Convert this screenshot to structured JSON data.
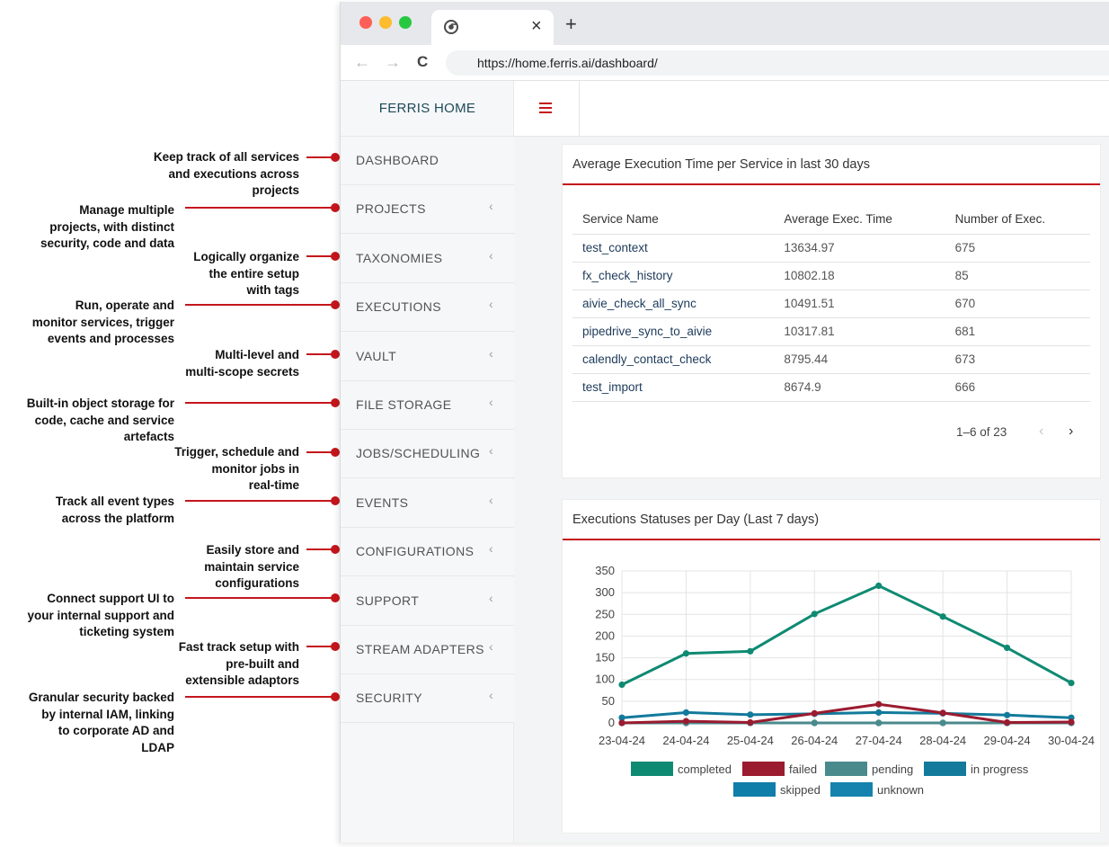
{
  "annotations": [
    {
      "lines": [
        "Keep track of all services",
        "and executions across",
        "projects"
      ]
    },
    {
      "lines": [
        "Manage multiple",
        "projects, with distinct",
        "security, code and data"
      ]
    },
    {
      "lines": [
        "Logically organize",
        "the entire setup",
        "with tags"
      ]
    },
    {
      "lines": [
        "Run, operate and",
        "monitor  services, trigger",
        "events and processes"
      ]
    },
    {
      "lines": [
        "Multi-level and",
        "multi-scope secrets"
      ]
    },
    {
      "lines": [
        "Built-in object storage for",
        "code, cache and service",
        "artefacts"
      ]
    },
    {
      "lines": [
        "Trigger, schedule and",
        "monitor jobs in",
        "real-time"
      ]
    },
    {
      "lines": [
        "Track all event types",
        "across the platform"
      ]
    },
    {
      "lines": [
        "Easily store and",
        "maintain service",
        "configurations"
      ]
    },
    {
      "lines": [
        "Connect support UI to",
        "your internal support and",
        "ticketing system"
      ]
    },
    {
      "lines": [
        "Fast track setup with",
        "pre-built and",
        "extensible adaptors"
      ]
    },
    {
      "lines": [
        "Granular security backed",
        "by internal IAM, linking",
        "to corporate AD and",
        "LDAP"
      ]
    }
  ],
  "browser": {
    "tab_close": "×",
    "new_tab": "+",
    "back": "←",
    "forward": "→",
    "reload": "C",
    "url": "https://home.ferris.ai/dashboard/"
  },
  "sidebar": {
    "brand": "FERRIS HOME",
    "items": [
      {
        "label": "DASHBOARD",
        "chevron": ""
      },
      {
        "label": "PROJECTS",
        "chevron": "‹"
      },
      {
        "label": "TAXONOMIES",
        "chevron": "‹"
      },
      {
        "label": "EXECUTIONS",
        "chevron": "‹"
      },
      {
        "label": "VAULT",
        "chevron": "‹"
      },
      {
        "label": "FILE STORAGE",
        "chevron": "‹"
      },
      {
        "label": "JOBS/SCHEDULING",
        "chevron": "‹"
      },
      {
        "label": "EVENTS",
        "chevron": "‹"
      },
      {
        "label": "CONFIGURATIONS",
        "chevron": "‹"
      },
      {
        "label": "SUPPORT",
        "chevron": "‹"
      },
      {
        "label": "STREAM ADAPTERS",
        "chevron": "‹"
      },
      {
        "label": "SECURITY",
        "chevron": "‹"
      }
    ]
  },
  "exec_time_card": {
    "title": "Average Execution Time per Service in last 30 days",
    "columns": [
      "Service Name",
      "Average Exec. Time",
      "Number of Exec."
    ],
    "rows": [
      [
        "test_context",
        "13634.97",
        "675"
      ],
      [
        "fx_check_history",
        "10802.18",
        "85"
      ],
      [
        "aivie_check_all_sync",
        "10491.51",
        "670"
      ],
      [
        "pipedrive_sync_to_aivie",
        "10317.81",
        "681"
      ],
      [
        "calendly_contact_check",
        "8795.44",
        "673"
      ],
      [
        "test_import",
        "8674.9",
        "666"
      ]
    ],
    "pagination": "1–6 of 23",
    "prev": "‹",
    "next": "›"
  },
  "status_card": {
    "title": "Executions Statuses per Day (Last 7 days)"
  },
  "chart_data": {
    "type": "line",
    "title": "Executions Statuses per Day (Last 7 days)",
    "categories": [
      "23-04-24",
      "24-04-24",
      "25-04-24",
      "26-04-24",
      "27-04-24",
      "28-04-24",
      "29-04-24",
      "30-04-24"
    ],
    "ylim": [
      0,
      350
    ],
    "yticks": [
      "0",
      "50",
      "100",
      "150",
      "200",
      "250",
      "300",
      "350"
    ],
    "grid": true,
    "legend_position": "bottom",
    "series": [
      {
        "name": "completed",
        "color": "#0f8a72",
        "values": [
          88,
          160,
          165,
          251,
          316,
          245,
          173,
          92
        ]
      },
      {
        "name": "failed",
        "color": "#9b1b2f",
        "values": [
          0,
          4,
          1,
          22,
          43,
          23,
          1,
          2
        ]
      },
      {
        "name": "pending",
        "color": "#4a8a8c",
        "values": [
          0,
          0,
          0,
          0,
          0,
          0,
          0,
          0
        ]
      },
      {
        "name": "in progress",
        "color": "#137a9b",
        "values": [
          12,
          24,
          19,
          21,
          24,
          22,
          18,
          12
        ]
      },
      {
        "name": "skipped",
        "color": "#0f7ea8",
        "values": [
          0,
          0,
          0,
          0,
          0,
          0,
          0,
          0
        ]
      },
      {
        "name": "unknown",
        "color": "#1583ad",
        "values": [
          0,
          0,
          0,
          0,
          0,
          0,
          0,
          0
        ]
      }
    ]
  },
  "colors": {
    "accent": "#c4161c",
    "brand_text": "#1d4a5a"
  }
}
